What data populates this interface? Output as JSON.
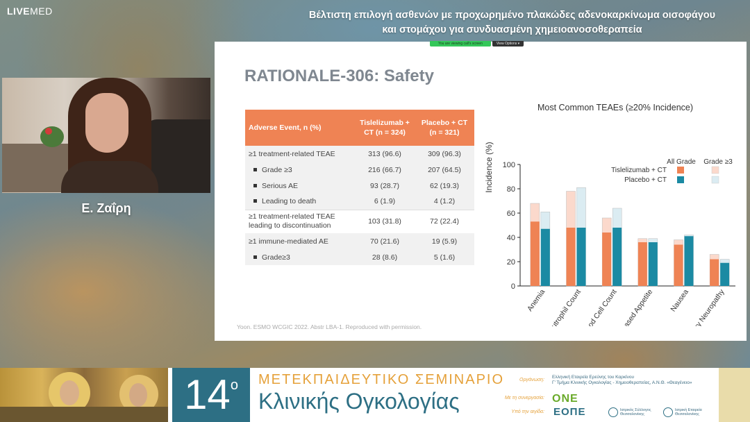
{
  "header": {
    "logo_live": "LIVE",
    "logo_med": "MED",
    "title_line1": "Βέλτιστη επιλογή ασθενών με προχωρημένο πλακώδες αδενοκαρκίνωμα οισοφάγου",
    "title_line2": "και στομάχου για συνδυασμένη χημειοανοσοθεραπεία"
  },
  "webcam": {
    "speaker_name": "Ε. Ζαΐρη"
  },
  "share_bar": {
    "viewing_text": "You are viewing call's screen",
    "options_text": "View Options ▾"
  },
  "slide": {
    "title": "RATIONALE-306: Safety",
    "footer": "Yoon. ESMO WCGIC 2022. Abstr LBA-1. Reproduced with permission.",
    "table": {
      "headers": [
        "Adverse Event, n (%)",
        "Tislelizumab + CT (n = 324)",
        "Placebo + CT (n = 321)"
      ],
      "rows": [
        {
          "label": "≥1 treatment-related TEAE",
          "a": "313 (96.6)",
          "b": "309 (96.3)"
        },
        {
          "label": "Grade ≥3",
          "a": "216 (66.7)",
          "b": "207 (64.5)"
        },
        {
          "label": "Serious AE",
          "a": "93 (28.7)",
          "b": "62 (19.3)"
        },
        {
          "label": "Leading to death",
          "a": "6 (1.9)",
          "b": "4 (1.2)"
        },
        {
          "label_line1": "≥1 treatment-related TEAE",
          "label_line2": "leading to discontinuation",
          "a": "103 (31.8)",
          "b": "72 (22.4)"
        },
        {
          "label": "≥1 immune-mediated AE",
          "a": "70 (21.6)",
          "b": "19 (5.9)"
        },
        {
          "label": "Grade≥3",
          "a": "28 (8.6)",
          "b": "5 (1.6)"
        }
      ]
    }
  },
  "chart_data": {
    "type": "bar",
    "title": "Most Common TEAEs (≥20% Incidence)",
    "ylabel": "Incidence (%)",
    "xlabel": "",
    "ylim": [
      0,
      100
    ],
    "yticks": [
      0,
      20,
      40,
      60,
      80,
      100
    ],
    "grid": false,
    "legend_position": "top-right",
    "legend": {
      "col_all": "All Grade",
      "col_g3": "Grade ≥3",
      "row_tis": "Tislelizumab + CT",
      "row_pla": "Placebo + CT"
    },
    "categories": [
      "Anemia",
      "Decreased Neutrophil Count",
      "Decreased White Blood Cell Count",
      "Decreased Appetite",
      "Nausea",
      "Peripheral Sensory Neuropathy"
    ],
    "series": [
      {
        "name": "Tislelizumab + CT",
        "all_grade": [
          68,
          78,
          56,
          39,
          38,
          26
        ],
        "grade3": [
          53,
          48,
          44,
          36,
          34,
          22
        ]
      },
      {
        "name": "Placebo + CT",
        "all_grade": [
          61,
          81,
          64,
          39,
          42,
          22
        ],
        "grade3": [
          47,
          48,
          48,
          36,
          41,
          19
        ]
      }
    ],
    "colors": {
      "tis_g3": "#ef8354",
      "tis_all": "#fbd9cc",
      "pla_g3": "#1b8aa3",
      "pla_all": "#dbecf2"
    }
  },
  "banner": {
    "number": "14",
    "superscript": "ο",
    "line1": "ΜΕΤΕΚΠΑΙΔΕΥΤΙΚΟ ΣΕΜΙΝΑΡΙΟ",
    "line2": "Κλινικής Ογκολογίας",
    "org_label": "Οργάνωση:",
    "org_text1": "Ελληνική Εταιρεία Ερεύνης του Καρκίνου",
    "org_text2": "Γ' Τμήμα Κλινικής Ογκολογίας - Χημειοθεραπείας, Α.Ν.Θ. «Θεαγένειο»",
    "collab_label": "Με τη συνεργασία:",
    "one": "ONE",
    "aegis_label": "Υπό την αιγίδα:",
    "eope": "ΕΟΠΕ",
    "iatrikos": "Ιατρικός Σύλλογος Θεσσαλονίκης",
    "iatriki": "Ιατρική Εταιρεία Θεσσαλονίκης"
  }
}
